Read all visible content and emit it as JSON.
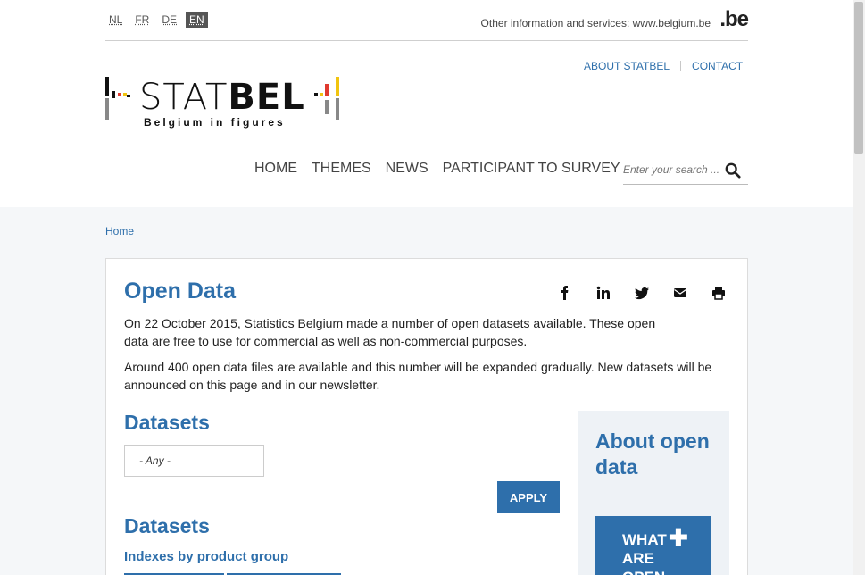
{
  "languages": [
    "NL",
    "FR",
    "DE",
    "EN"
  ],
  "active_language": "EN",
  "top": {
    "belgium_link": "Other information and services: www.belgium.be",
    "be_logo": ".be"
  },
  "secondary_nav": [
    "ABOUT STATBEL",
    "CONTACT"
  ],
  "logo": {
    "text_light": "STAT",
    "text_bold": "BEL",
    "tagline": "Belgium in figures",
    "colors": [
      "#111111",
      "#f1c40f",
      "#e03a2f",
      "#888888"
    ]
  },
  "main_nav": [
    "HOME",
    "THEMES",
    "NEWS",
    "PARTICIPANT TO SURVEY"
  ],
  "search": {
    "placeholder": "Enter your search ..."
  },
  "breadcrumb": "Home",
  "page": {
    "title": "Open Data",
    "share_icons": [
      "facebook-icon",
      "linkedin-icon",
      "twitter-icon",
      "email-icon",
      "print-icon"
    ],
    "intro_1": "On 22 October 2015, Statistics Belgium made a number of open datasets available. These open data are free to use for commercial as well as non-commercial purposes.",
    "intro_2": "Around 400 open data files are available and this number will be expanded gradually. New datasets will be announced on this page and in our newsletter.",
    "datasets_heading": "Datasets",
    "filter_value": "- Any -",
    "apply_label": "Apply",
    "datasets_heading_2": "Datasets",
    "dataset_link": "Indexes by product group"
  },
  "sidebar": {
    "title": "About open data",
    "box_label": "What are open data?",
    "box_visible": "WHAT ARE OPEN"
  },
  "colors": {
    "accent": "#2e6fab",
    "background": "#f5f7f9"
  }
}
